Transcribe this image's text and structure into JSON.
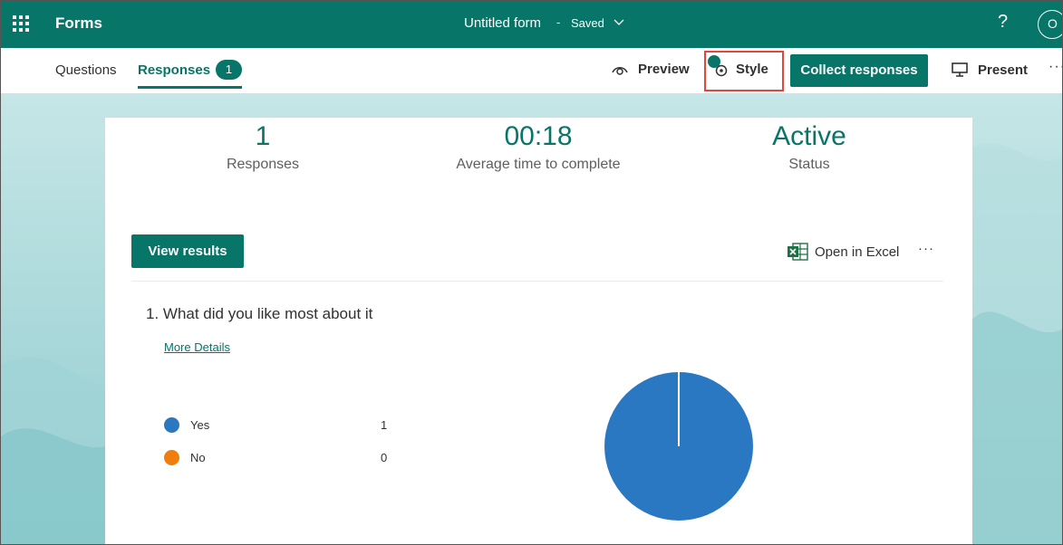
{
  "header": {
    "app_name": "Forms",
    "form_title": "Untitled form",
    "separator": "-",
    "save_status": "Saved",
    "help": "?",
    "avatar_initial": "O"
  },
  "commandbar": {
    "tab_questions": "Questions",
    "tab_responses": "Responses",
    "responses_badge": "1",
    "preview": "Preview",
    "style": "Style",
    "collect_responses": "Collect responses",
    "present": "Present",
    "more": "···"
  },
  "summary": {
    "responses_value": "1",
    "responses_caption": "Responses",
    "avg_time_value": "00:18",
    "avg_time_caption": "Average time to complete",
    "status_value": "Active",
    "status_caption": "Status"
  },
  "actions": {
    "view_results": "View results",
    "open_in_excel": "Open in Excel",
    "more": "···"
  },
  "question": {
    "number_and_text": "1.  What did you like most about it",
    "more_details": "More Details",
    "options": [
      {
        "label": "Yes",
        "count": "1",
        "color": "#2b78c2"
      },
      {
        "label": "No",
        "count": "0",
        "color": "#f07d0c"
      }
    ]
  },
  "chart_data": {
    "type": "pie",
    "categories": [
      "Yes",
      "No"
    ],
    "values": [
      1,
      0
    ],
    "colors": [
      "#2b78c2",
      "#f07d0c"
    ]
  },
  "theme": {
    "accent": "#077568",
    "highlight_box": "#e0473d"
  }
}
